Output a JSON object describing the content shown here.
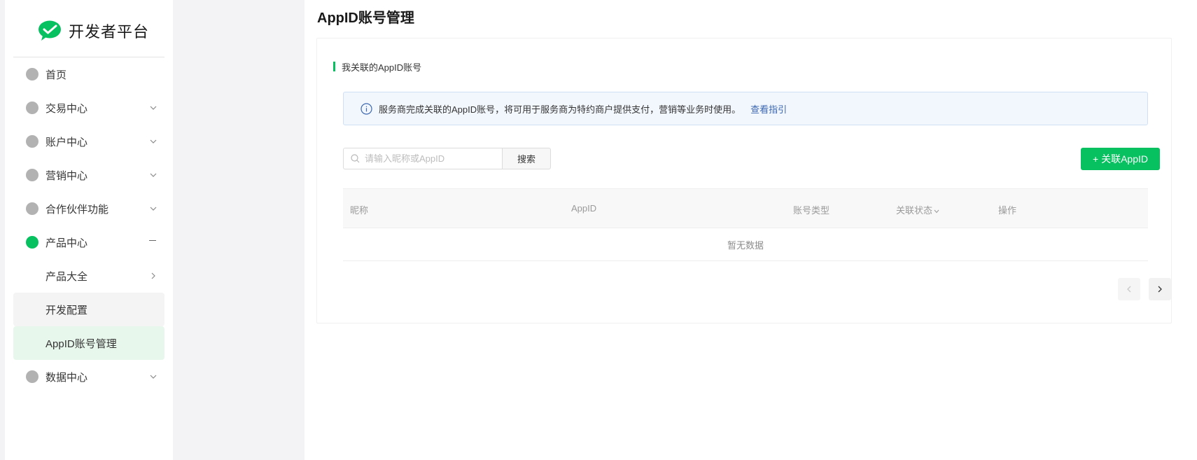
{
  "logo": {
    "text": "开发者平台",
    "icon": "wechat-pay-logo-icon"
  },
  "sidebar": {
    "items": [
      {
        "label": "首页",
        "icon": "circle-icon",
        "expandable": false
      },
      {
        "label": "交易中心",
        "icon": "circle-icon",
        "expandable": true
      },
      {
        "label": "账户中心",
        "icon": "circle-icon",
        "expandable": true
      },
      {
        "label": "营销中心",
        "icon": "circle-icon",
        "expandable": true
      },
      {
        "label": "合作伙伴功能",
        "icon": "circle-icon",
        "expandable": true
      },
      {
        "label": "产品中心",
        "icon": "circle-icon",
        "expanded": true,
        "active": true
      },
      {
        "label": "数据中心",
        "icon": "circle-icon",
        "expandable": true
      }
    ],
    "sub_items": [
      {
        "label": "产品大全",
        "has_arrow": true
      },
      {
        "label": "开发配置"
      },
      {
        "label": "AppID账号管理",
        "selected": true
      }
    ],
    "colors": {
      "active_dot": "#07c160",
      "inactive_dot": "#b2b2b2",
      "selected_bg": "#e8f7ec"
    }
  },
  "main": {
    "page_title": "AppID账号管理",
    "section_title": "我关联的AppID账号",
    "notice": {
      "text": "服务商完成关联的AppID账号，将可用于服务商为特约商户提供支付，营销等业务时使用。",
      "link": "查看指引"
    },
    "search": {
      "placeholder": "请输入昵称或AppID",
      "button_label": "搜索"
    },
    "add_button_label": "+ 关联AppID",
    "table": {
      "columns": [
        "昵称",
        "AppID",
        "账号类型",
        "关联状态",
        "操作"
      ],
      "empty_text": "暂无数据"
    },
    "accent_color": "#07c160",
    "link_color": "#3c67b0"
  }
}
